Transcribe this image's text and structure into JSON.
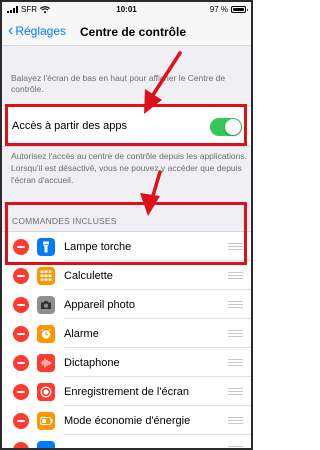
{
  "status_bar": {
    "carrier": "SFR",
    "time": "10:01",
    "battery": "97 %",
    "battery_level": 0.97
  },
  "navbar": {
    "back_label": "Réglages",
    "title": "Centre de contrôle"
  },
  "intro_text": "Balayez l'écran de bas en haut pour afficher le Centre de contrôle.",
  "access": {
    "label": "Accès à partir des apps",
    "enabled": true
  },
  "access_description": "Autorisez l'accès au centre de contrôle depuis les applications. Lorsqu'il est désactivé, vous ne pouvez y accéder que depuis l'écran d'accueil.",
  "included_header": "COMMANDES INCLUSES",
  "controls": [
    {
      "label": "Lampe torche",
      "icon": "flashlight-icon",
      "color": "#007aff"
    },
    {
      "label": "Calculette",
      "icon": "calculator-icon",
      "color": "#ff9500"
    },
    {
      "label": "Appareil photo",
      "icon": "camera-icon",
      "color": "#8e8e93"
    },
    {
      "label": "Alarme",
      "icon": "alarm-icon",
      "color": "#ff9500"
    },
    {
      "label": "Dictaphone",
      "icon": "voice-memo-icon",
      "color": "#ff3b30"
    },
    {
      "label": "Enregistrement de l'écran",
      "icon": "screen-recording-icon",
      "color": "#ff3b30"
    },
    {
      "label": "Mode économie d'énergie",
      "icon": "low-power-icon",
      "color": "#ff9500"
    }
  ],
  "colors": {
    "accent": "#007aff",
    "toggle_on": "#34c759",
    "delete": "#ff3b30",
    "annotation": "#e0101a"
  }
}
